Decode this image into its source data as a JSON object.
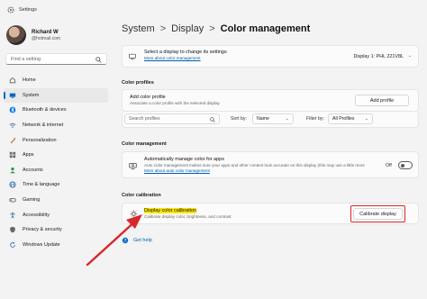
{
  "window": {
    "title": "Settings"
  },
  "profile": {
    "name": "Richard W",
    "email": "@hotmail.com"
  },
  "search": {
    "placeholder": "Find a setting"
  },
  "nav": [
    {
      "label": "Home",
      "icon": "home-icon",
      "active": false
    },
    {
      "label": "System",
      "icon": "system-icon",
      "active": true
    },
    {
      "label": "Bluetooth & devices",
      "icon": "bluetooth-icon",
      "active": false
    },
    {
      "label": "Network & internet",
      "icon": "network-icon",
      "active": false
    },
    {
      "label": "Personalization",
      "icon": "personalization-icon",
      "active": false
    },
    {
      "label": "Apps",
      "icon": "apps-icon",
      "active": false
    },
    {
      "label": "Accounts",
      "icon": "accounts-icon",
      "active": false
    },
    {
      "label": "Time & language",
      "icon": "time-language-icon",
      "active": false
    },
    {
      "label": "Gaming",
      "icon": "gaming-icon",
      "active": false
    },
    {
      "label": "Accessibility",
      "icon": "accessibility-icon",
      "active": false
    },
    {
      "label": "Privacy & security",
      "icon": "privacy-security-icon",
      "active": false
    },
    {
      "label": "Windows Update",
      "icon": "windows-update-icon",
      "active": false
    }
  ],
  "breadcrumb": {
    "part1": "System",
    "part2": "Display",
    "current": "Color management",
    "separator": ">"
  },
  "display_select": {
    "title": "Select a display to change its settings",
    "link": "More about color management",
    "value": "Display 1: PHL 221V8L"
  },
  "color_profiles": {
    "section": "Color profiles",
    "add_title": "Add color profile",
    "add_sub": "Associate a color profile with the selected display",
    "add_button": "Add profile",
    "search_placeholder": "Search profiles",
    "sort_label": "Sort by:",
    "sort_value": "Name",
    "filter_label": "Filter by:",
    "filter_value": "All Profiles"
  },
  "color_management": {
    "section": "Color management",
    "title": "Automatically manage color for apps",
    "sub": "Auto color management makes sure your apps and other content look accurate on this display (this may use a little more power)",
    "link": "More about auto color management",
    "toggle_label": "Off",
    "toggle_on": false
  },
  "color_calibration": {
    "section": "Color calibration",
    "title": "Display color calibration",
    "sub": "Calibrate display color, brightness, and contrast",
    "button": "Calibrate display"
  },
  "help": {
    "label": "Get help"
  },
  "colors": {
    "accent": "#0067c0",
    "highlight": "#ffe600",
    "annotation_red": "#d8262c"
  }
}
